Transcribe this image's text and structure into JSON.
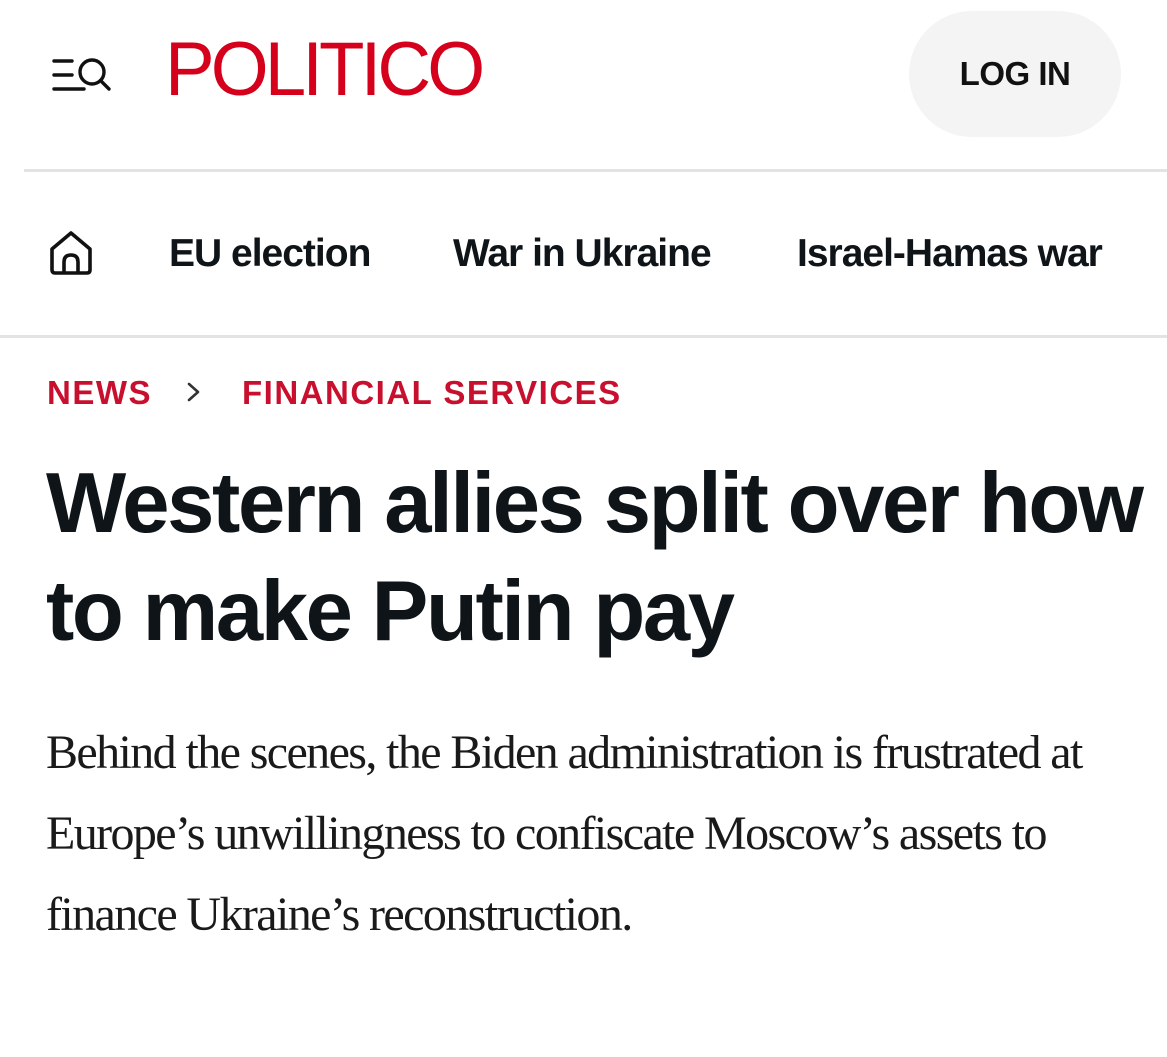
{
  "header": {
    "logo": "POLITICO",
    "menu_icon": "menu-search-icon",
    "login_label": "LOG IN",
    "brand_color": "#d5001c"
  },
  "nav": {
    "home_icon": "home-icon",
    "items": [
      {
        "label": "EU election"
      },
      {
        "label": "War in Ukraine"
      },
      {
        "label": "Israel-Hamas war"
      }
    ]
  },
  "breadcrumb": {
    "items": [
      {
        "label": "NEWS"
      },
      {
        "label": "FINANCIAL SERVICES"
      }
    ],
    "separator_icon": "chevron-right-icon",
    "color": "#c8102e"
  },
  "article": {
    "headline": "Western allies split over how to make Putin pay",
    "dek": "Behind the scenes, the Biden administration is frustrated at Europe’s unwillingness to confiscate Moscow’s assets to finance Ukraine’s reconstruction."
  }
}
